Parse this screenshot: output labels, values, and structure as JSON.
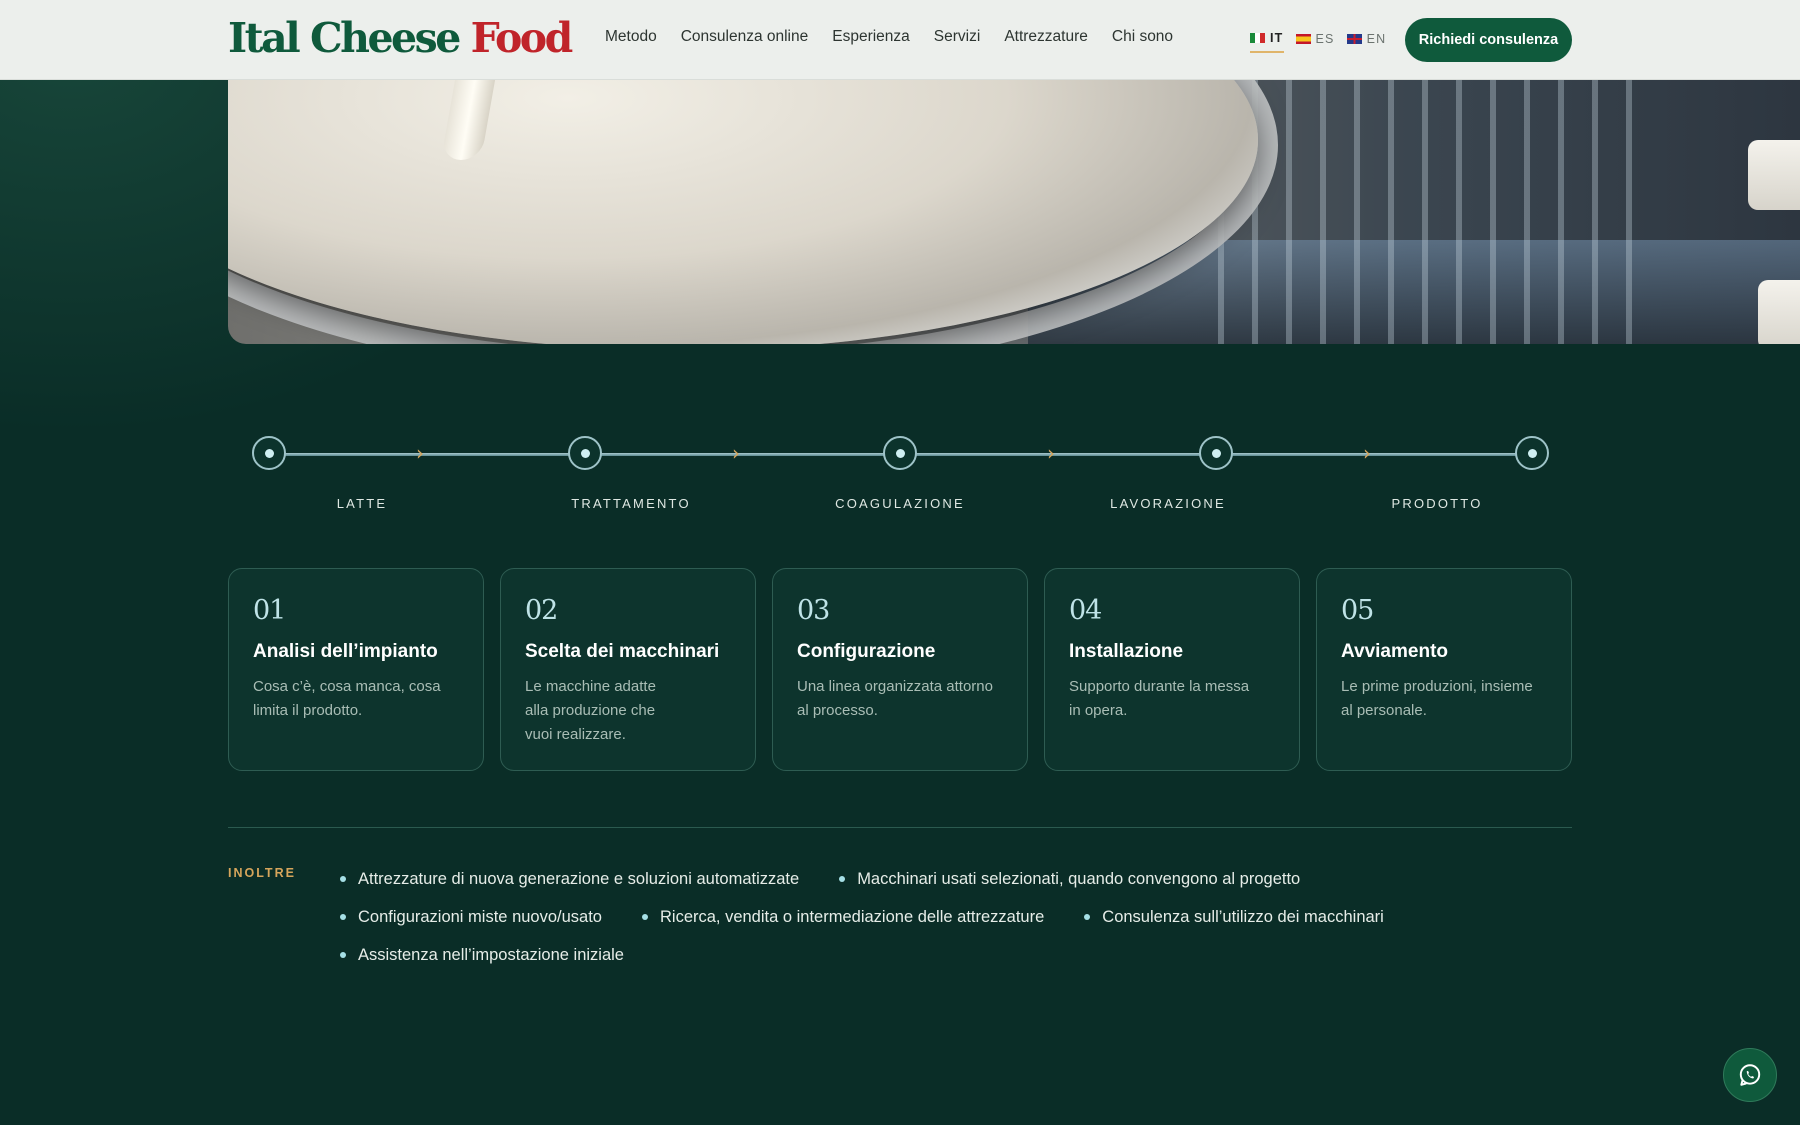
{
  "header": {
    "logo": {
      "part1": "Ital Cheese",
      "part2": "Food"
    },
    "nav": [
      "Metodo",
      "Consulenza online",
      "Esperienza",
      "Servizi",
      "Attrezzature",
      "Chi sono"
    ],
    "languages": [
      {
        "code": "IT",
        "flag": "flag-it-icon",
        "active": true
      },
      {
        "code": "ES",
        "flag": "flag-es-icon",
        "active": false
      },
      {
        "code": "EN",
        "flag": "flag-en-icon",
        "active": false
      }
    ],
    "cta_label": "Richiedi consulenza"
  },
  "process_steps": [
    "LATTE",
    "TRATTAMENTO",
    "COAGULAZIONE",
    "LAVORAZIONE",
    "PRODOTTO"
  ],
  "cards": [
    {
      "num": "01",
      "title": "Analisi dell’impianto",
      "text": "Cosa c’è, cosa manca, cosa limita il prodotto."
    },
    {
      "num": "02",
      "title": "Scelta dei macchinari",
      "text": "Le macchine adatte alla produzione che vuoi realizzare."
    },
    {
      "num": "03",
      "title": "Configurazione",
      "text": "Una linea organizzata attorno al processo."
    },
    {
      "num": "04",
      "title": "Installazione",
      "text": "Supporto durante la messa in opera."
    },
    {
      "num": "05",
      "title": "Avviamento",
      "text": "Le prime produzioni, insieme al personale."
    }
  ],
  "extras": {
    "label": "INOLTRE",
    "rows": [
      [
        "Attrezzature di nuova generazione e soluzioni automatizzate",
        "Macchinari usati selezionati, quando convengono al progetto"
      ],
      [
        "Configurazioni miste nuovo/usato",
        "Ricerca, vendita o intermediazione delle attrezzature",
        "Consulenza sull’utilizzo dei macchinari"
      ],
      [
        "Assistenza nell’impostazione iniziale"
      ]
    ]
  },
  "colors": {
    "background": "#0a2d27",
    "brand_green": "#0f5a3c",
    "brand_red": "#c0242a",
    "accent_gold": "#d6a55b",
    "accent_cyan": "#a6e0e6"
  },
  "icons": {
    "whatsapp": "whatsapp-icon",
    "arrow": "arrow-right-icon"
  }
}
